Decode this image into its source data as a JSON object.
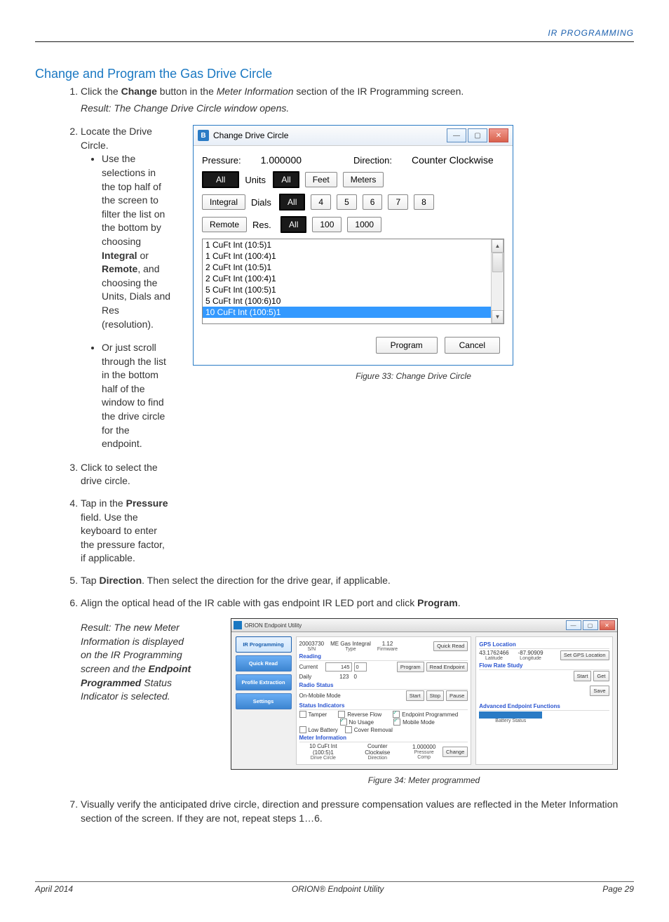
{
  "header_right": "IR PROGRAMMING",
  "page_title": "Change and Program the Gas Drive Circle",
  "step1": {
    "pre": "Click the ",
    "bold": "Change",
    "mid": " button in the ",
    "italic": "Meter Information",
    "post": " section of the IR Programming screen.",
    "result": "Result: The Change Drive Circle window opens."
  },
  "step2": {
    "text": "Locate the Drive Circle.",
    "bullet1_pre": "Use the selections in the top half of the screen to filter the list on the bottom by choosing ",
    "bullet1_b1": "Integral",
    "bullet1_mid": " or ",
    "bullet1_b2": "Remote",
    "bullet1_post": ", and choosing the Units, Dials and Res (resolution).",
    "bullet2": "Or just scroll through the list in the bottom half of the window to find the drive circle for the endpoint."
  },
  "step3": "Click to select the drive circle.",
  "step4": {
    "pre": "Tap in the ",
    "bold": "Pressure",
    "post": " field. Use the keyboard to enter the pressure factor, if applicable."
  },
  "step5": {
    "pre": "Tap ",
    "bold": "Direction",
    "post": ". Then select the direction for the drive gear, if applicable."
  },
  "step6": {
    "pre": "Align the optical head of the IR cable with gas endpoint IR LED port and click ",
    "bold": "Program",
    "post": "."
  },
  "step6_result": {
    "pre": "Result: The new Meter Information is displayed on the IR Programming screen and the ",
    "bold": "Endpoint Programmed",
    "post": " Status Indicator is selected."
  },
  "step7": "Visually verify the anticipated drive circle, direction and pressure compensation values are reflected in the Meter Information section of the screen. If they are not, repeat steps 1…6.",
  "fig33": {
    "caption": "Figure 33:  Change Drive Circle",
    "win_title": "Change Drive Circle",
    "pressure_label": "Pressure:",
    "pressure_value": "1.000000",
    "direction_label": "Direction:",
    "direction_value": "Counter Clockwise",
    "units_label": "Units",
    "dials_label": "Dials",
    "res_label": "Res.",
    "feet": "Feet",
    "meters": "Meters",
    "integral": "Integral",
    "remote": "Remote",
    "all": "All",
    "nums": {
      "n4": "4",
      "n5": "5",
      "n6": "6",
      "n7": "7",
      "n8": "8",
      "n100": "100",
      "n1000": "1000"
    },
    "list": {
      "i0": "1 CuFt Int (10:5)1",
      "i1": "1 CuFt Int (100:4)1",
      "i2": "2 CuFt Int (10:5)1",
      "i3": "2 CuFt Int (100:4)1",
      "i4": "5 CuFt Int (100:5)1",
      "i5": "5 CuFt Int (100:6)10",
      "i6": "10 CuFt Int (100:5)1"
    },
    "program_btn": "Program",
    "cancel_btn": "Cancel"
  },
  "fig34": {
    "caption": "Figure 34:  Meter programmed",
    "win_title": "ORION Endpoint Utility",
    "nav": {
      "ir": "IR Programming",
      "qr": "Quick Read",
      "pe": "Profile Extraction",
      "set": "Settings"
    },
    "header": {
      "sn": "20003730",
      "sn_lbl": "S/N",
      "type": "ME Gas Integral",
      "type_lbl": "Type",
      "fw": "1.12",
      "fw_lbl": "Firmware",
      "quick_read": "Quick Read"
    },
    "reading": {
      "title": "Reading",
      "current": "Current",
      "current_v": "145",
      "current_v2": "0",
      "daily": "Daily",
      "daily_v": "123",
      "daily_v2": "0",
      "program": "Program",
      "read_ep": "Read Endpoint"
    },
    "radio": {
      "title": "Radio Status",
      "mode": "On-Mobile Mode",
      "start": "Start",
      "stop": "Stop",
      "pause": "Pause"
    },
    "status": {
      "title": "Status Indicators",
      "tamper": "Tamper",
      "rev": "Reverse Flow",
      "ep": "Endpoint Programmed",
      "nou": "No Usage",
      "mm": "Mobile Mode",
      "low": "Low Battery",
      "cov": "Cover Removal"
    },
    "meter": {
      "title": "Meter Information",
      "dc": "10 CuFt Int (100:5)1",
      "dc_lbl": "Drive Circle",
      "dir": "Counter Clockwise",
      "dir_lbl": "Direction",
      "pc": "1.000000",
      "pc_lbl": "Pressure Comp",
      "change": "Change"
    },
    "gps": {
      "title": "GPS Location",
      "lat": "43.1762466",
      "lat_lbl": "Latitude",
      "lon": "-87.90909",
      "lon_lbl": "Longitude",
      "set": "Set GPS Location"
    },
    "flow": {
      "title": "Flow Rate Study",
      "start": "Start",
      "get": "Get",
      "save": "Save"
    },
    "adv": {
      "title": "Advanced Endpoint Functions",
      "bat": "Battery Status"
    }
  },
  "footer": {
    "left": "April 2014",
    "center": "ORION® Endpoint Utility",
    "right": "Page 29"
  }
}
